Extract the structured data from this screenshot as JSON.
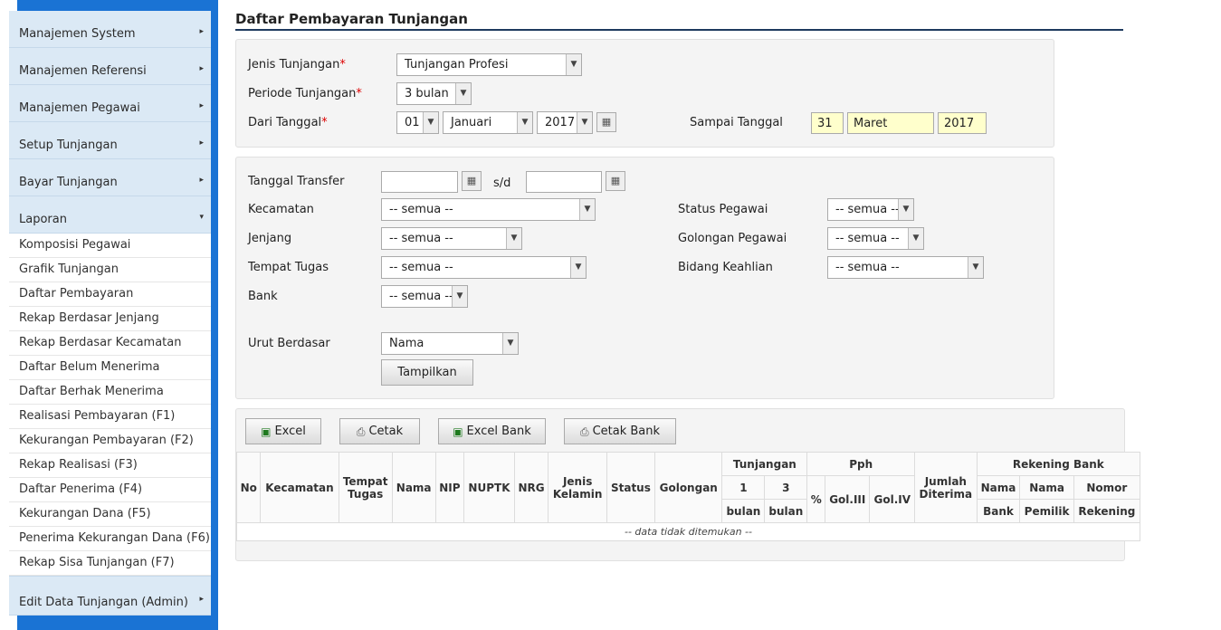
{
  "sidebar": {
    "sections": [
      "Manajemen System",
      "Manajemen Referensi",
      "Manajemen Pegawai",
      "Setup Tunjangan",
      "Bayar Tunjangan",
      "Laporan"
    ],
    "laporan_items": [
      "Komposisi Pegawai",
      "Grafik Tunjangan",
      "Daftar Pembayaran",
      "Rekap Berdasar Jenjang",
      "Rekap Berdasar Kecamatan",
      "Daftar Belum Menerima",
      "Daftar Berhak Menerima",
      "Realisasi Pembayaran (F1)",
      "Kekurangan Pembayaran (F2)",
      "Rekap Realisasi (F3)",
      "Daftar Penerima (F4)",
      "Kekurangan Dana (F5)",
      "Penerima Kekurangan Dana (F6)",
      "Rekap Sisa Tunjangan (F7)"
    ],
    "last_section": "Edit Data Tunjangan (Admin)"
  },
  "page": {
    "title": "Daftar Pembayaran Tunjangan"
  },
  "form1": {
    "jenis_label": "Jenis Tunjangan",
    "jenis_value": "Tunjangan Profesi",
    "periode_label": "Periode Tunjangan",
    "periode_value": "3 bulan",
    "dari_label": "Dari Tanggal",
    "dari_day": "01",
    "dari_month": "Januari",
    "dari_year": "2017",
    "sampai_label": "Sampai Tanggal",
    "sampai_day": "31",
    "sampai_month": "Maret",
    "sampai_year": "2017",
    "required_mark": "*"
  },
  "form2": {
    "transfer_label": "Tanggal Transfer",
    "sd_label": "s/d",
    "kecamatan_label": "Kecamatan",
    "kecamatan_value": "-- semua --",
    "jenjang_label": "Jenjang",
    "jenjang_value": "-- semua --",
    "tempat_label": "Tempat Tugas",
    "tempat_value": "-- semua --",
    "bank_label": "Bank",
    "bank_value": "-- semua --",
    "status_label": "Status Pegawai",
    "status_value": "-- semua --",
    "golongan_label": "Golongan Pegawai",
    "golongan_value": "-- semua --",
    "bidang_label": "Bidang Keahlian",
    "bidang_value": "-- semua --",
    "urut_label": "Urut Berdasar",
    "urut_value": "Nama",
    "submit_label": "Tampilkan"
  },
  "toolbar": {
    "excel": "Excel",
    "cetak": "Cetak",
    "excel_bank": "Excel Bank",
    "cetak_bank": "Cetak Bank"
  },
  "table": {
    "h_no": "No",
    "h_kecamatan": "Kecamatan",
    "h_tempat1": "Tempat",
    "h_tempat2": "Tugas",
    "h_nama": "Nama",
    "h_nip": "NIP",
    "h_nuptk": "NUPTK",
    "h_nrg": "NRG",
    "h_jk1": "Jenis",
    "h_jk2": "Kelamin",
    "h_status": "Status",
    "h_golongan": "Golongan",
    "h_tunjangan": "Tunjangan",
    "h_t1a": "1",
    "h_t1b": "bulan",
    "h_t3a": "3",
    "h_t3b": "bulan",
    "h_pph": "Pph",
    "h_pct": "%",
    "h_gol3": "Gol.III",
    "h_gol4": "Gol.IV",
    "h_jml1": "Jumlah",
    "h_jml2": "Diterima",
    "h_rek": "Rekening Bank",
    "h_nb1": "Nama",
    "h_nb2": "Bank",
    "h_np1": "Nama",
    "h_np2": "Pemilik",
    "h_nr1": "Nomor",
    "h_nr2": "Rekening",
    "empty": "-- data tidak ditemukan --"
  },
  "icons": {
    "arrow_right": "▸",
    "arrow_down": "▾",
    "dropdown": "▼",
    "calendar": "▦",
    "excel": "▣",
    "printer": "⎙"
  }
}
